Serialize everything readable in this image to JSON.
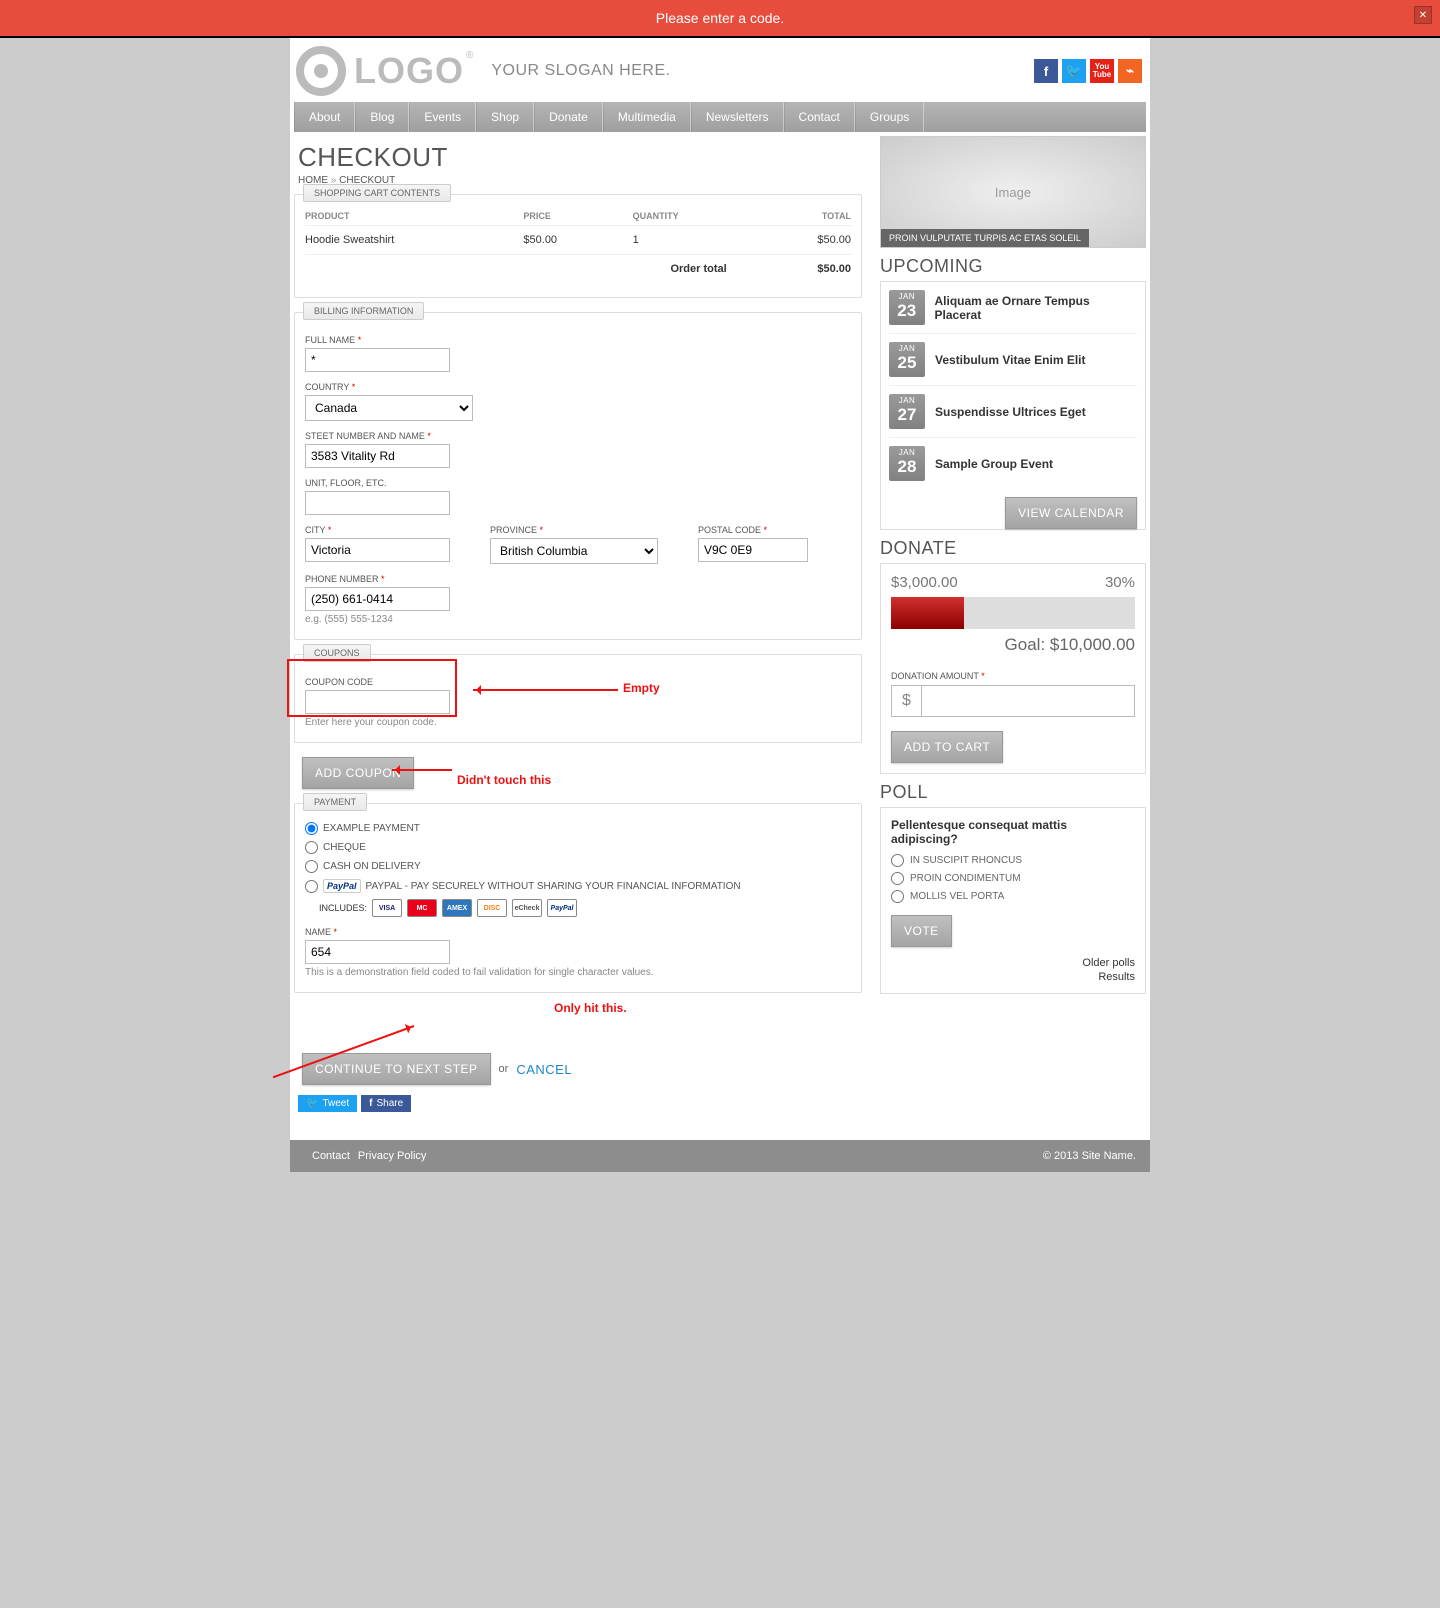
{
  "alert": {
    "text": "Please enter a code.",
    "close": "✕"
  },
  "header": {
    "logo": "LOGO",
    "reg": "®",
    "slogan": "YOUR SLOGAN HERE."
  },
  "social": {
    "fb": "f",
    "tw_glyph": "🐦",
    "yt_top": "You",
    "yt_bot": "Tube",
    "rss": "⌁"
  },
  "nav": [
    "About",
    "Blog",
    "Events",
    "Shop",
    "Donate",
    "Multimedia",
    "Newsletters",
    "Contact",
    "Groups"
  ],
  "page": {
    "title": "CHECKOUT",
    "crumb_home": "HOME",
    "crumb_sep": "»",
    "crumb_current": "CHECKOUT"
  },
  "cart": {
    "legend": "SHOPPING CART CONTENTS",
    "hdr_product": "PRODUCT",
    "hdr_price": "PRICE",
    "hdr_qty": "QUANTITY",
    "hdr_total": "TOTAL",
    "item_name": "Hoodie Sweatshirt",
    "item_price": "$50.00",
    "item_qty": "1",
    "item_total": "$50.00",
    "order_total_label": "Order total",
    "order_total": "$50.00"
  },
  "billing": {
    "legend": "BILLING INFORMATION",
    "full_name_label": "FULL NAME",
    "full_name": "*",
    "country_label": "COUNTRY",
    "country": "Canada",
    "street_label": "STEET NUMBER AND NAME",
    "street": "3583 Vitality Rd",
    "unit_label": "UNIT, FLOOR, ETC.",
    "unit": "",
    "city_label": "CITY",
    "city": "Victoria",
    "province_label": "PROVINCE",
    "province": "British Columbia",
    "postal_label": "POSTAL CODE",
    "postal": "V9C 0E9",
    "phone_label": "PHONE NUMBER",
    "phone": "(250) 661-0414",
    "phone_hint": "e.g. (555) 555-1234"
  },
  "coupons": {
    "legend": "COUPONS",
    "label": "COUPON CODE",
    "value": "",
    "hint": "Enter here your coupon code.",
    "button": "ADD COUPON"
  },
  "payment": {
    "legend": "PAYMENT",
    "opt_example": "EXAMPLE PAYMENT",
    "opt_cheque": "CHEQUE",
    "opt_cod": "CASH ON DELIVERY",
    "opt_paypal": "PAYPAL - PAY SECURELY WITHOUT SHARING YOUR FINANCIAL INFORMATION",
    "paypal_badge": "PayPal",
    "includes": "INCLUDES:",
    "cc": [
      "VISA",
      "MC",
      "AMEX",
      "DISC",
      "eCheck",
      "PayPal"
    ],
    "name_label": "NAME",
    "name_value": "654",
    "name_hint": "This is a demonstration field coded to fail validation for single character values."
  },
  "actions": {
    "continue": "CONTINUE TO NEXT STEP",
    "or": "or",
    "cancel": "CANCEL"
  },
  "sharebar": {
    "tweet": "Tweet",
    "share": "Share"
  },
  "footer": {
    "contact": "Contact",
    "privacy": "Privacy Policy",
    "copy": "© 2013 Site Name."
  },
  "hero": {
    "placeholder": "Image",
    "caption": "PROIN VULPUTATE TURPIS AC ETAS SOLEIL"
  },
  "upcoming": {
    "title": "UPCOMING",
    "events": [
      {
        "mon": "JAN",
        "day": "23",
        "title": "Aliquam ae Ornare Tempus Placerat"
      },
      {
        "mon": "JAN",
        "day": "25",
        "title": "Vestibulum Vitae Enim Elit"
      },
      {
        "mon": "JAN",
        "day": "27",
        "title": "Suspendisse Ultrices Eget"
      },
      {
        "mon": "JAN",
        "day": "28",
        "title": "Sample Group Event"
      }
    ],
    "button": "VIEW CALENDAR"
  },
  "donate": {
    "title": "DONATE",
    "raised": "$3,000.00",
    "percent": "30%",
    "percent_num": 30,
    "goal_label": "Goal:",
    "goal": "$10,000.00",
    "amount_label": "DONATION AMOUNT",
    "prefix": "$",
    "button": "ADD TO CART"
  },
  "poll": {
    "title": "POLL",
    "question": "Pellentesque consequat mattis adipiscing?",
    "opts": [
      "IN SUSCIPIT RHONCUS",
      "PROIN CONDIMENTUM",
      "MOLLIS VEL PORTA"
    ],
    "button": "VOTE",
    "older": "Older polls",
    "results": "Results"
  },
  "annotations": {
    "empty": "Empty",
    "didnt_touch": "Didn't touch this",
    "only_hit": "Only hit this."
  }
}
